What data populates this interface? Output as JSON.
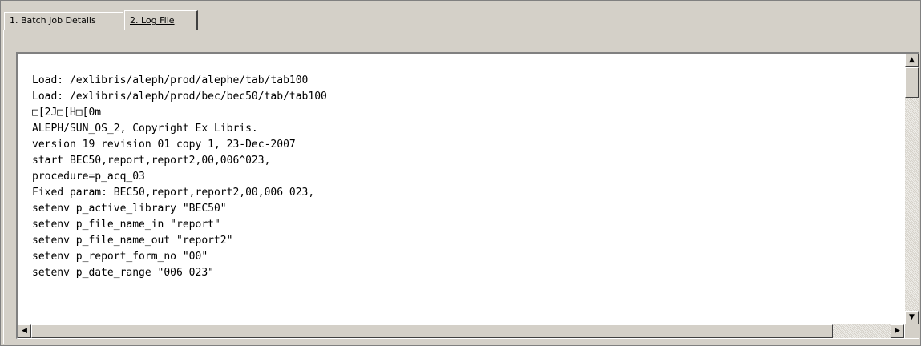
{
  "tabs": [
    {
      "label": "1. Batch Job Details",
      "active": false
    },
    {
      "label": "2. Log File",
      "active": true
    }
  ],
  "log": {
    "lines": [
      "Load: /exlibris/aleph/prod/alephe/tab/tab100",
      "Load: /exlibris/aleph/prod/bec/bec50/tab/tab100",
      "□[2J□[H□[0m",
      "ALEPH/SUN_OS_2, Copyright Ex Libris.",
      "version 19 revision 01 copy 1, 23-Dec-2007",
      "start BEC50,report,report2,00,006^023,",
      "procedure=p_acq_03",
      "Fixed param: BEC50,report,report2,00,006 023,",
      "setenv p_active_library \"BEC50\"",
      "setenv p_file_name_in \"report\"",
      "setenv p_file_name_out \"report2\"",
      "setenv p_report_form_no \"00\"",
      "setenv p_date_range \"006 023\""
    ]
  },
  "icons": {
    "up": "up-arrow-icon",
    "down": "down-arrow-icon",
    "left": "left-arrow-icon",
    "right": "right-arrow-icon"
  }
}
